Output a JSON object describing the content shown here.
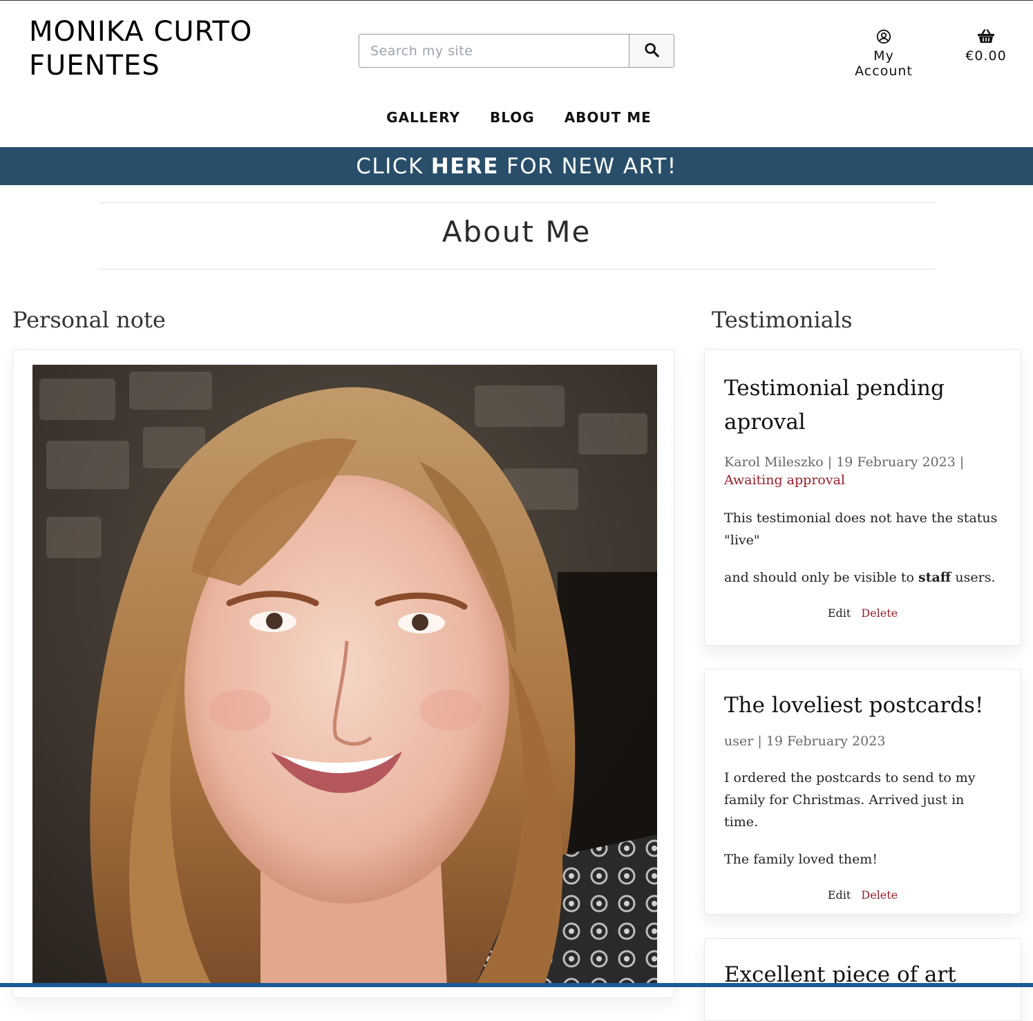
{
  "header": {
    "brand_line1": "MONIKA CURTO",
    "brand_line2": "FUENTES",
    "search_placeholder": "Search my site",
    "account_label": "My Account",
    "cart_total": "€0.00"
  },
  "nav": {
    "items": [
      {
        "label": "GALLERY"
      },
      {
        "label": "BLOG"
      },
      {
        "label": "ABOUT ME"
      }
    ]
  },
  "banner": {
    "pre": "CLICK",
    "bold": "HERE",
    "post": "FOR NEW ART!"
  },
  "page": {
    "title": "About Me"
  },
  "personal_note": {
    "heading": "Personal note"
  },
  "testimonials": {
    "heading": "Testimonials",
    "items": [
      {
        "title": "Testimonial pending aproval",
        "meta": "Karol Mileszko | 19 February 2023 |",
        "status": "Awaiting approval",
        "para1": "This testimonial does not have the status \"live\"",
        "para2_pre": "and should only be visible to ",
        "para2_bold": "staff",
        "para2_post": " users.",
        "edit": "Edit",
        "delete": "Delete"
      },
      {
        "title": "The loveliest postcards!",
        "meta": "user | 19 February 2023",
        "para1": "I ordered the postcards to send to my family for Christmas. Arrived just in time.",
        "para2": "The family loved them!",
        "edit": "Edit",
        "delete": "Delete"
      },
      {
        "title": "Excellent piece of art"
      }
    ]
  },
  "colors": {
    "banner": "#294e6a",
    "danger": "#9b1c2a",
    "bottom_bar": "#1b5a96"
  }
}
